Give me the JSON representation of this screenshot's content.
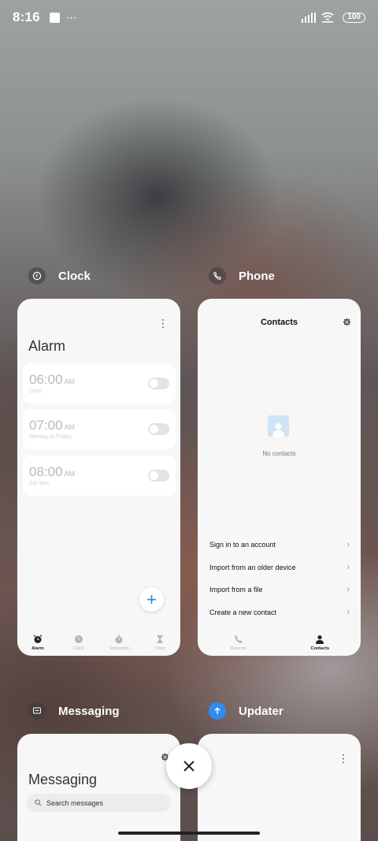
{
  "status_bar": {
    "time": "8:16",
    "menu_dots": "⋯",
    "battery": "100"
  },
  "apps": {
    "clock": {
      "name": "Clock",
      "icon": "clock-app-icon",
      "screen_title": "Alarm",
      "menu_glyph": "⋮",
      "alarms": [
        {
          "time": "06:00",
          "ampm": "AM",
          "repeat": "Daily",
          "enabled": false
        },
        {
          "time": "07:00",
          "ampm": "AM",
          "repeat": "Monday to Friday",
          "enabled": false
        },
        {
          "time": "08:00",
          "ampm": "AM",
          "repeat": "Sat Sun",
          "enabled": false
        }
      ],
      "fab_glyph": "+",
      "tabs": [
        {
          "label": "Alarm",
          "icon": "alarm-icon",
          "active": true
        },
        {
          "label": "Clock",
          "icon": "clock-icon",
          "active": false
        },
        {
          "label": "Stopwatch",
          "icon": "stopwatch-icon",
          "active": false
        },
        {
          "label": "Timer",
          "icon": "hourglass-icon",
          "active": false
        }
      ]
    },
    "phone": {
      "name": "Phone",
      "icon": "phone-app-icon",
      "screen_title": "Contacts",
      "empty_text": "No contacts",
      "chevron": "›",
      "menu": [
        {
          "label": "Sign in to an account"
        },
        {
          "label": "Import from an older device"
        },
        {
          "label": "Import from a file"
        },
        {
          "label": "Create a new contact"
        }
      ],
      "tabs": [
        {
          "label": "Recents",
          "icon": "phone-icon",
          "active": false
        },
        {
          "label": "Contacts",
          "icon": "person-icon",
          "active": true
        }
      ]
    },
    "messaging": {
      "name": "Messaging",
      "icon": "messaging-app-icon",
      "screen_title": "Messaging",
      "search_placeholder": "Search messages"
    },
    "updater": {
      "name": "Updater",
      "icon": "updater-app-icon",
      "menu_glyph": "⋮"
    }
  },
  "colors": {
    "accent": "#2a86d8",
    "updater_icon": "#2f8cf0"
  }
}
